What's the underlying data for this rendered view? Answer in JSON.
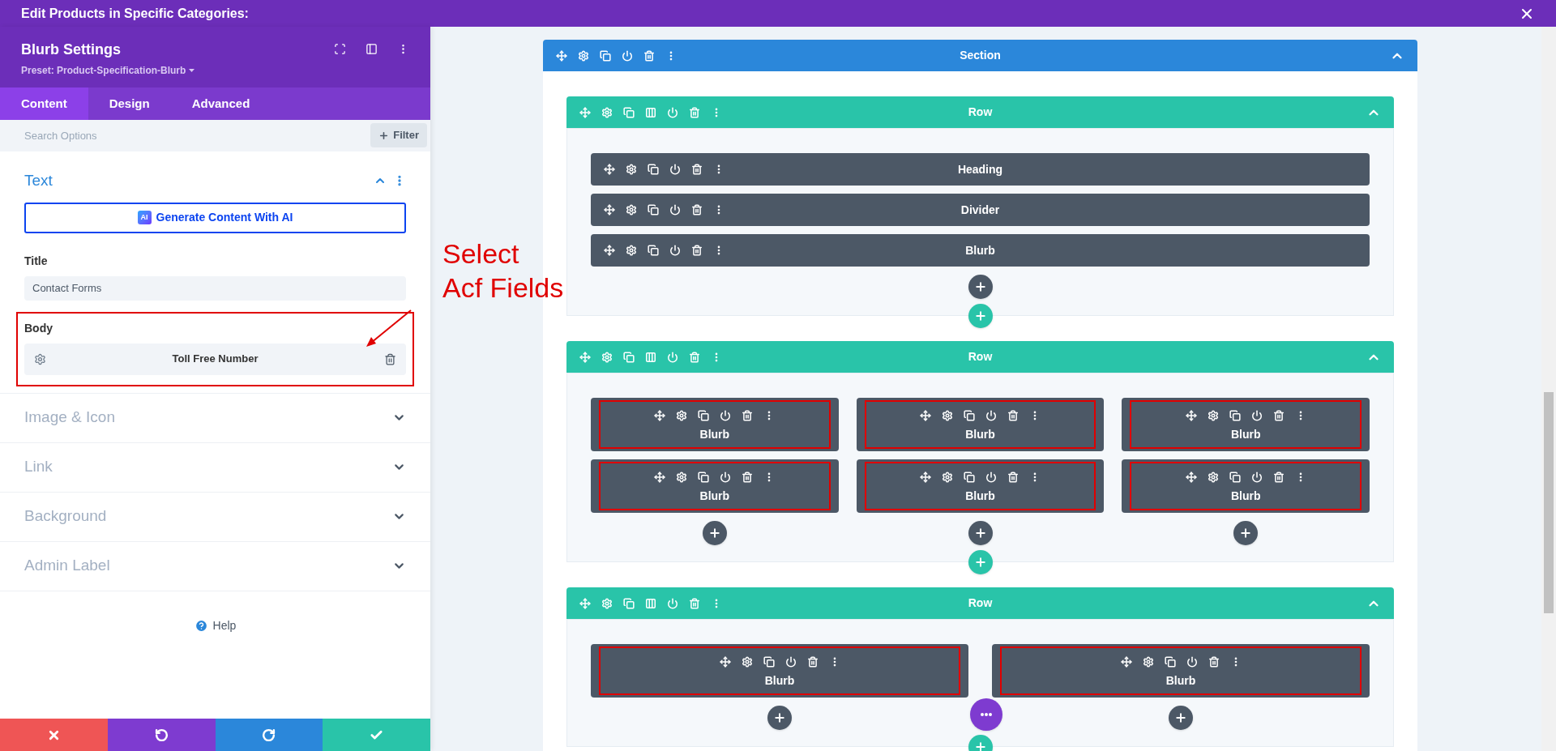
{
  "window": {
    "title": "Edit Products in Specific Categories:"
  },
  "settings": {
    "title": "Blurb Settings",
    "preset": "Preset: Product-Specification-Blurb",
    "tabs": [
      {
        "label": "Content",
        "selected": true
      },
      {
        "label": "Design",
        "selected": false
      },
      {
        "label": "Advanced",
        "selected": false
      }
    ],
    "search": {
      "placeholder": "Search Options"
    },
    "filter": "Filter",
    "open_group": {
      "title": "Text",
      "expanded": true,
      "ai_badge": "AI",
      "generate_button": "Generate Content With AI",
      "fields": [
        {
          "label": "Title",
          "kind": "text",
          "value": "Contact Forms",
          "highlighted": false
        },
        {
          "label": "Body",
          "kind": "dynamic",
          "value": "Toll Free Number",
          "highlighted": true
        }
      ]
    },
    "groups": [
      {
        "title": "Image & Icon",
        "expanded": false
      },
      {
        "title": "Link",
        "expanded": false
      },
      {
        "title": "Background",
        "expanded": false
      },
      {
        "title": "Admin Label",
        "expanded": false
      }
    ],
    "help": "Help"
  },
  "annotation": {
    "lines": [
      "Select",
      "Acf Fields"
    ]
  },
  "builder": {
    "section": {
      "label": "Section",
      "expanded": true
    },
    "rows": [
      {
        "label": "Row",
        "expanded": true,
        "columns": [
          [
            {
              "label": "Heading",
              "kind": "bar",
              "highlighted": false
            },
            {
              "label": "Divider",
              "kind": "bar",
              "highlighted": false
            },
            {
              "label": "Blurb",
              "kind": "bar",
              "highlighted": false
            }
          ]
        ]
      },
      {
        "label": "Row",
        "expanded": true,
        "columns": [
          [
            {
              "label": "Blurb",
              "kind": "card",
              "highlighted": true
            },
            {
              "label": "Blurb",
              "kind": "card",
              "highlighted": true
            }
          ],
          [
            {
              "label": "Blurb",
              "kind": "card",
              "highlighted": true
            },
            {
              "label": "Blurb",
              "kind": "card",
              "highlighted": true
            }
          ],
          [
            {
              "label": "Blurb",
              "kind": "card",
              "highlighted": true
            },
            {
              "label": "Blurb",
              "kind": "card",
              "highlighted": true
            }
          ]
        ]
      },
      {
        "label": "Row",
        "expanded": true,
        "columns": [
          [
            {
              "label": "Blurb",
              "kind": "card",
              "highlighted": true
            }
          ],
          [
            {
              "label": "Blurb",
              "kind": "card",
              "highlighted": true
            }
          ]
        ]
      }
    ]
  }
}
